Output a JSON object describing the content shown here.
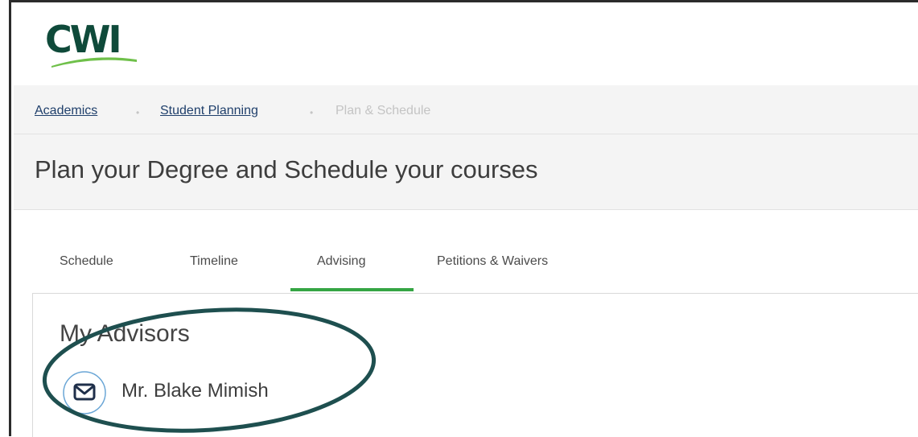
{
  "logo": {
    "text": "CWI"
  },
  "breadcrumb": [
    {
      "label": "Academics"
    },
    {
      "label": "Student Planning"
    },
    {
      "label": "Plan & Schedule"
    }
  ],
  "breadcrumb_separator": "•",
  "page_title": "Plan your Degree and Schedule your courses",
  "tabs": [
    {
      "label": "Schedule"
    },
    {
      "label": "Timeline"
    },
    {
      "label": "Advising",
      "selected": true
    },
    {
      "label": "Petitions & Waivers"
    }
  ],
  "advisors": {
    "heading": "My Advisors",
    "items": [
      {
        "name": "Mr. Blake Mimish",
        "icon": "envelope-icon"
      }
    ]
  },
  "colors": {
    "logo": "#0f4a3a",
    "accent_green": "#35a544",
    "link": "#1f3f6b",
    "highlight_ring": "#1e4f4f"
  }
}
